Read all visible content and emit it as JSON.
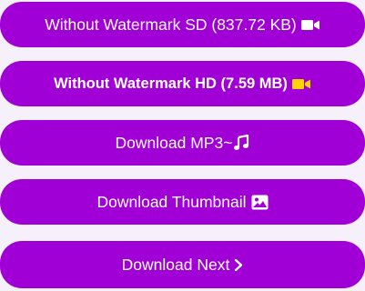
{
  "buttons": {
    "sd": {
      "label": "Without Watermark SD (837.72 KB)",
      "icon": "video-camera-icon",
      "icon_color": "#ffffff"
    },
    "hd": {
      "label": "Without Watermark HD (7.59 MB)",
      "icon": "video-camera-icon",
      "icon_color": "#ffd400"
    },
    "mp3": {
      "label": "Download MP3~",
      "icon": "music-note-icon",
      "icon_color": "#ffffff"
    },
    "thumbnail": {
      "label": "Download Thumbnail",
      "icon": "image-icon",
      "icon_color": "#ffffff"
    },
    "next": {
      "label": "Download Next",
      "icon": "chevron-right-icon",
      "icon_color": "#ffffff"
    }
  },
  "colors": {
    "button_bg": "#a000d6",
    "page_bg": "#f5f0fa"
  }
}
